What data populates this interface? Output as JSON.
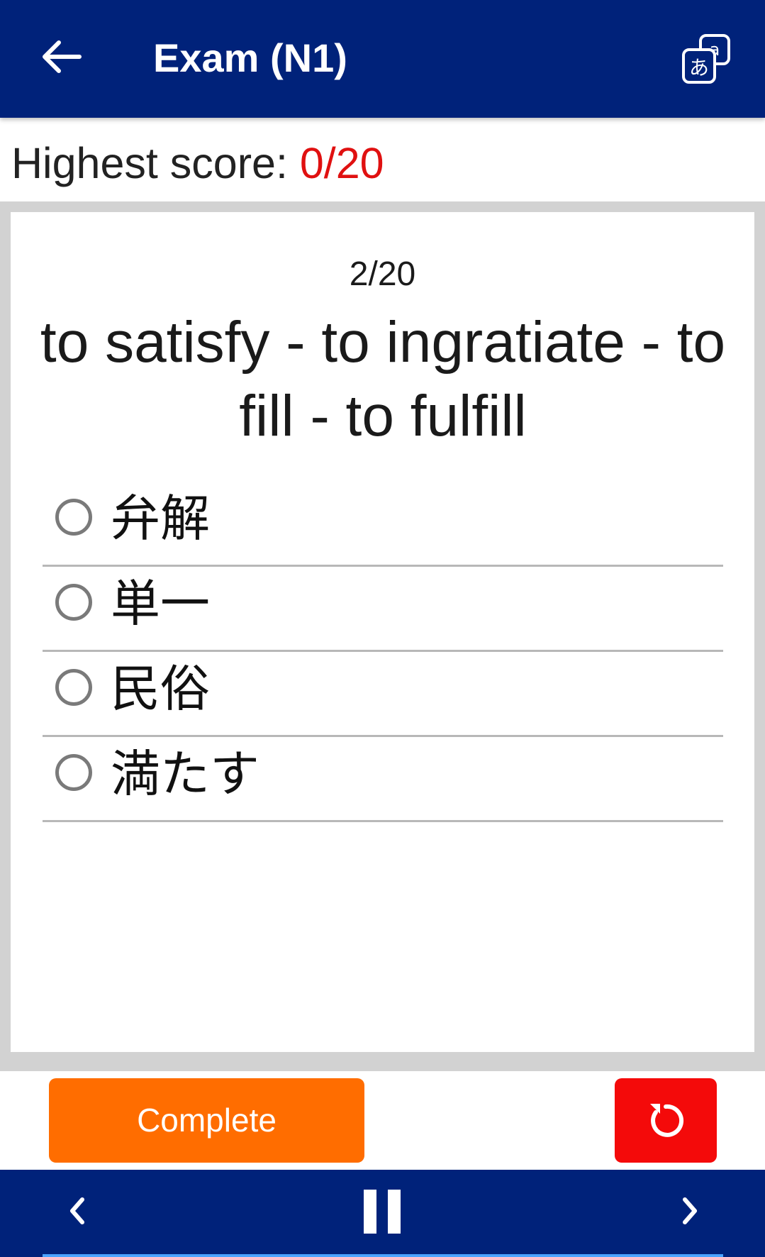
{
  "appbar": {
    "title": "Exam (N1)",
    "back_icon": "arrow-left-icon",
    "translate_icon": "translate-icon",
    "background": "#00227a"
  },
  "score": {
    "label": "Highest score: ",
    "value": "0/20",
    "value_color": "#e01010"
  },
  "quiz": {
    "counter": "2/20",
    "question": "to satisfy - to ingratiate - to fill - to fulfill",
    "options": [
      {
        "label": "弁解",
        "selected": false
      },
      {
        "label": "単一",
        "selected": false
      },
      {
        "label": "民俗",
        "selected": false
      },
      {
        "label": "満たす",
        "selected": false
      }
    ]
  },
  "actions": {
    "complete_label": "Complete",
    "complete_color": "#ff6d00",
    "reset_icon": "reset-icon",
    "reset_color": "#f40a0a"
  },
  "bottombar": {
    "prev_icon": "chevron-left-icon",
    "pause_icon": "pause-icon",
    "next_icon": "chevron-right-icon"
  }
}
